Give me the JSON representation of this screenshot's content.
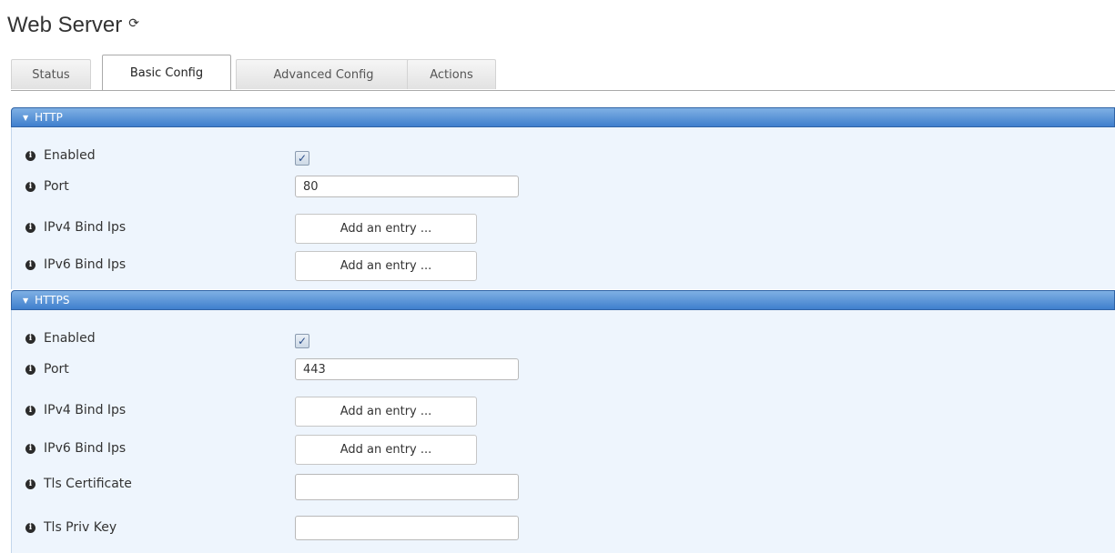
{
  "page": {
    "title": "Web Server",
    "refresh_icon": "refresh-icon"
  },
  "tabs": [
    {
      "label": "Status"
    },
    {
      "label": "Basic Config",
      "active": true
    },
    {
      "label": "Advanced Config"
    },
    {
      "label": "Actions"
    }
  ],
  "http": {
    "title": "HTTP",
    "enabled_label": "Enabled",
    "enabled": true,
    "port_label": "Port",
    "port_value": "80",
    "ipv4_label": "IPv4 Bind Ips",
    "ipv4_button": "Add an entry ...",
    "ipv6_label": "IPv6 Bind Ips",
    "ipv6_button": "Add an entry ..."
  },
  "https": {
    "title": "HTTPS",
    "enabled_label": "Enabled",
    "enabled": true,
    "port_label": "Port",
    "port_value": "443",
    "ipv4_label": "IPv4 Bind Ips",
    "ipv4_button": "Add an entry ...",
    "ipv6_label": "IPv6 Bind Ips",
    "ipv6_button": "Add an entry ...",
    "cert_label": "Tls Certificate",
    "cert_value": "",
    "key_label": "Tls Priv Key",
    "key_value": ""
  },
  "colors": {
    "header": "#3f7fcd",
    "panel": "#eef5fd"
  },
  "icons": {
    "info": "info-icon",
    "check": "checkmark-icon",
    "caret": "caret-down-icon"
  }
}
